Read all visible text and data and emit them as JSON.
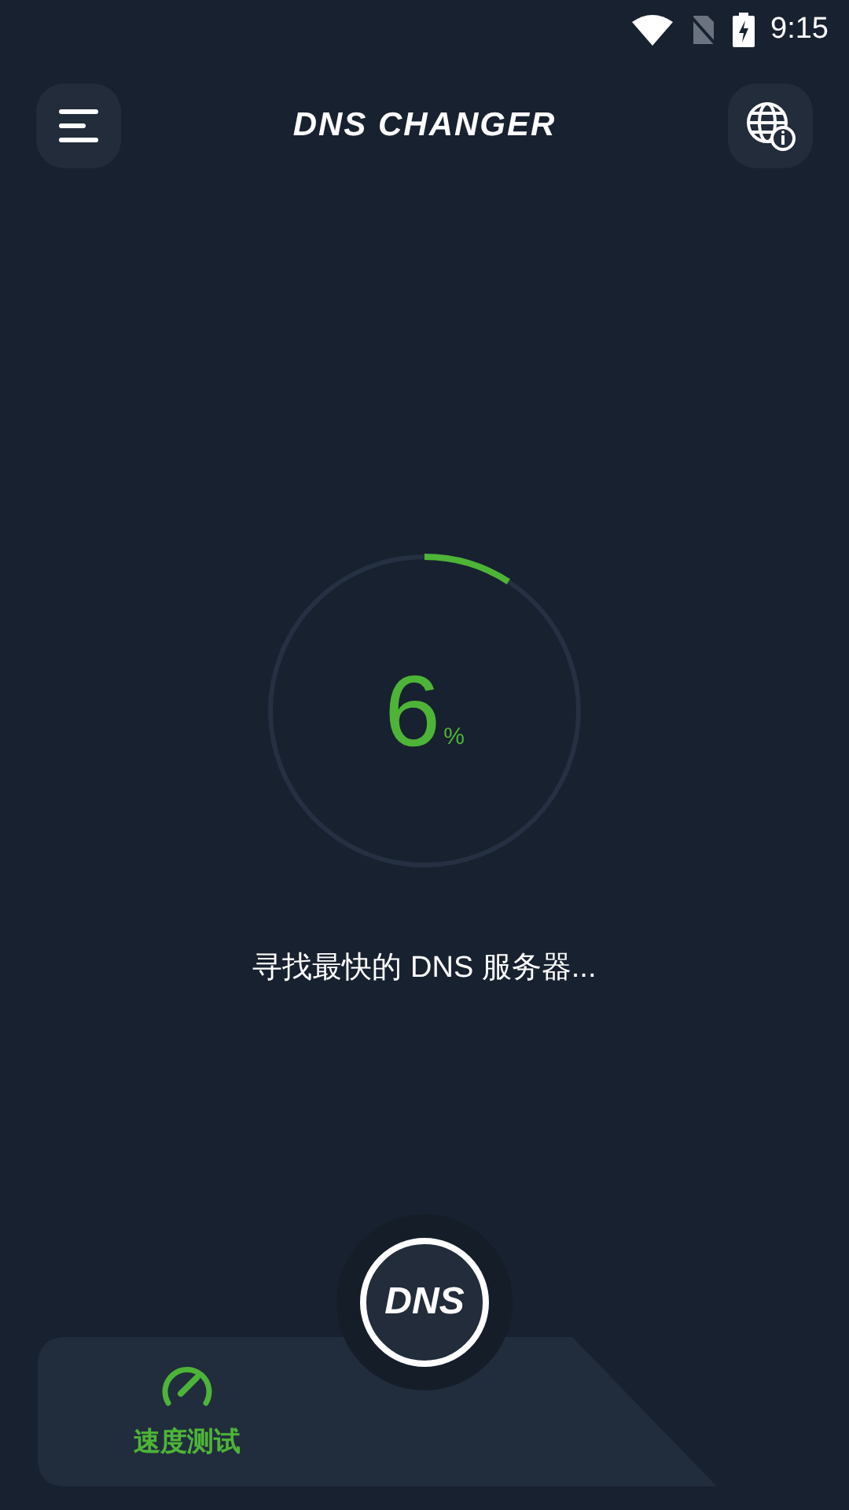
{
  "status_bar": {
    "time": "9:15"
  },
  "header": {
    "title": "DNS CHANGER"
  },
  "progress": {
    "value": "6",
    "unit": "%",
    "message": "寻找最快的 DNS 服务器..."
  },
  "center_button": {
    "label": "DNS"
  },
  "bottom_nav": [
    {
      "label": "速度测试",
      "selected": true
    }
  ]
}
